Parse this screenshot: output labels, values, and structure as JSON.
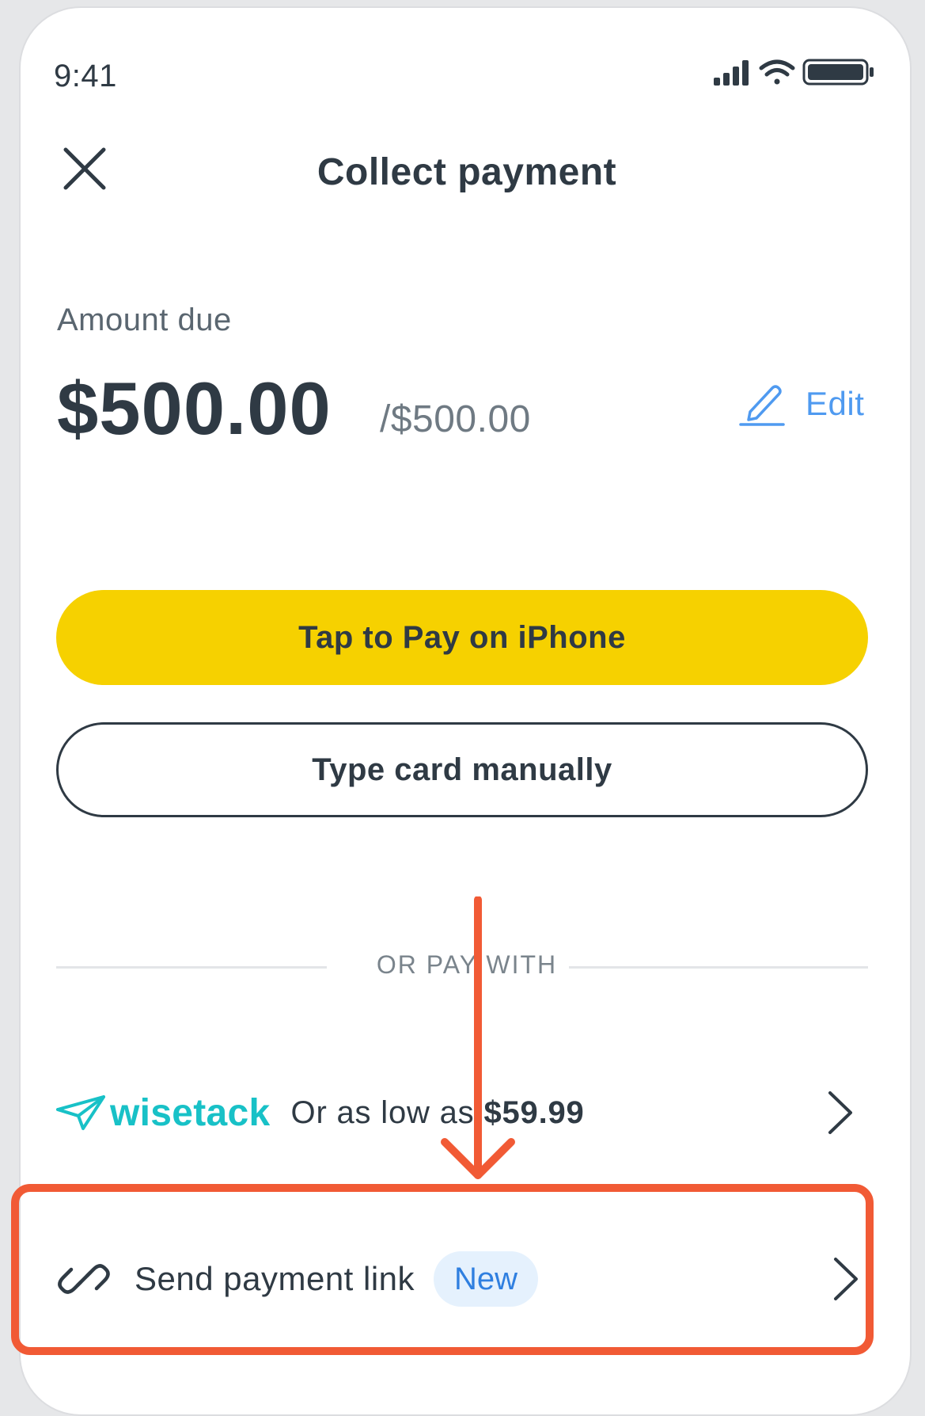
{
  "status_bar": {
    "time": "9:41",
    "icons": [
      "cellular-signal-icon",
      "wifi-icon",
      "battery-icon"
    ]
  },
  "header": {
    "title": "Collect payment",
    "close_icon": "close-icon"
  },
  "amount": {
    "label": "Amount due",
    "value": "$500.00",
    "total": "/$500.00",
    "edit_label": "Edit"
  },
  "buttons": {
    "tap_to_pay": "Tap to Pay on iPhone",
    "type_card": "Type card manually"
  },
  "divider": {
    "label": "OR PAY WITH"
  },
  "wisetack": {
    "brand": "wisetack",
    "text": "Or as low as",
    "price": "$59.99"
  },
  "payment_link": {
    "label": "Send payment link",
    "badge": "New"
  },
  "colors": {
    "primary_yellow": "#f6d100",
    "text_dark": "#2f3a44",
    "link_blue": "#4f9af0",
    "wisetack_teal": "#18c1c7",
    "highlight_orange": "#f15a35",
    "badge_bg": "#e5f1fd"
  }
}
